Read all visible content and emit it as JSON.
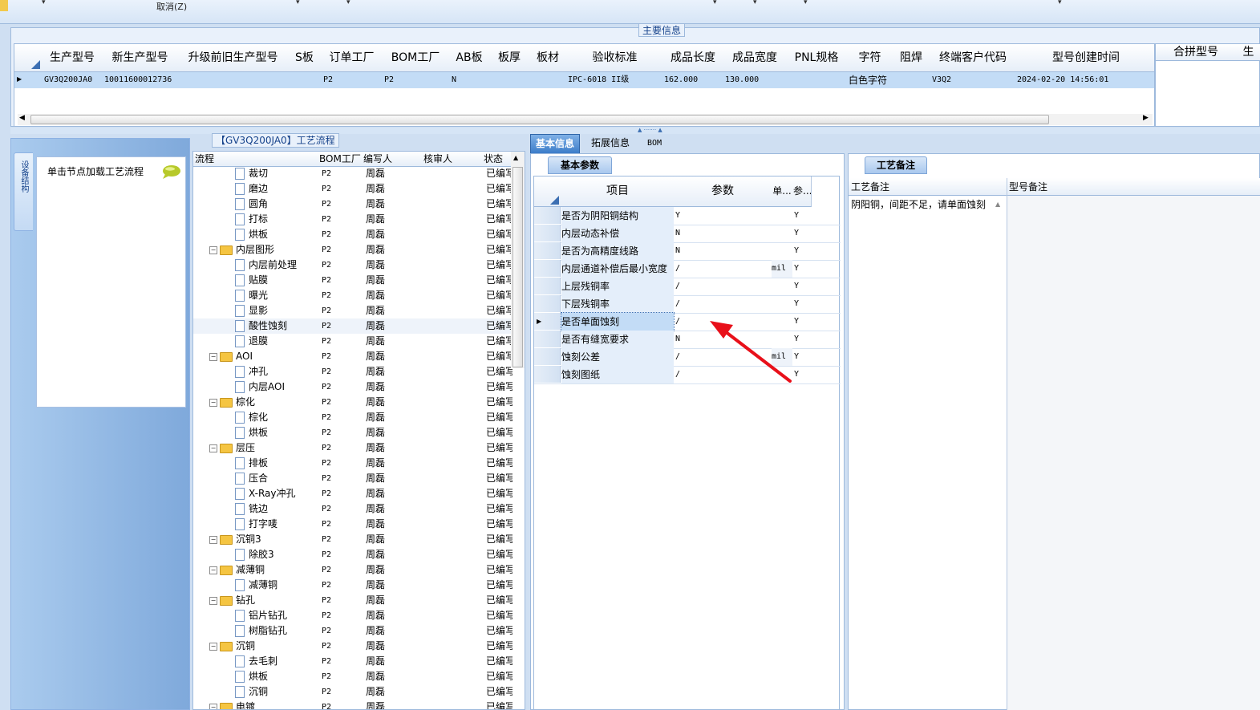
{
  "toolbar": {
    "cancel_label": "取消(Z)"
  },
  "main_info": {
    "group_title": "主要信息",
    "columns": [
      "生产型号",
      "新生产型号",
      "升级前旧生产型号",
      "S板",
      "订单工厂",
      "BOM工厂",
      "AB板",
      "板厚",
      "板材",
      "验收标准",
      "成品长度",
      "成品宽度",
      "PNL规格",
      "字符",
      "阻焊",
      "终端客户代码",
      "型号创建时间"
    ],
    "row": {
      "model": "GV3Q200JA0",
      "new_model": "10011600012736",
      "old_model": "",
      "s_board": "",
      "order_factory": "P2",
      "bom_factory": "P2",
      "ab_board": "N",
      "thickness": "",
      "material": "",
      "standard": "IPC-6018 II级",
      "length": "162.000",
      "width": "130.000",
      "pnl": "",
      "char": "白色字符",
      "solder": "",
      "customer_code": "V3Q2",
      "created": "2024-02-20 14:56:01"
    },
    "merge_columns": [
      "合拼型号",
      "生"
    ]
  },
  "left_panel": {
    "tab_label": "设备结构",
    "node_hint": "单击节点加载工艺流程"
  },
  "process_tree": {
    "title": "【GV3Q200JA0】工艺流程",
    "columns": [
      "流程",
      "BOM工厂",
      "编写人",
      "核审人",
      "状态"
    ],
    "rows": [
      {
        "name": "裁切",
        "level": 2,
        "type": "doc",
        "bom": "P2",
        "writer": "周磊",
        "status": "已编写"
      },
      {
        "name": "磨边",
        "level": 2,
        "type": "doc",
        "bom": "P2",
        "writer": "周磊",
        "status": "已编写"
      },
      {
        "name": "圆角",
        "level": 2,
        "type": "doc",
        "bom": "P2",
        "writer": "周磊",
        "status": "已编写"
      },
      {
        "name": "打标",
        "level": 2,
        "type": "doc",
        "bom": "P2",
        "writer": "周磊",
        "status": "已编写"
      },
      {
        "name": "烘板",
        "level": 2,
        "type": "doc",
        "bom": "P2",
        "writer": "周磊",
        "status": "已编写"
      },
      {
        "name": "内层图形",
        "level": 1,
        "type": "folder",
        "bom": "P2",
        "writer": "周磊",
        "status": "已编写"
      },
      {
        "name": "内层前处理",
        "level": 2,
        "type": "doc",
        "bom": "P2",
        "writer": "周磊",
        "status": "已编写"
      },
      {
        "name": "贴膜",
        "level": 2,
        "type": "doc",
        "bom": "P2",
        "writer": "周磊",
        "status": "已编写"
      },
      {
        "name": "曝光",
        "level": 2,
        "type": "doc",
        "bom": "P2",
        "writer": "周磊",
        "status": "已编写"
      },
      {
        "name": "显影",
        "level": 2,
        "type": "doc",
        "bom": "P2",
        "writer": "周磊",
        "status": "已编写"
      },
      {
        "name": "酸性蚀刻",
        "level": 2,
        "type": "doc",
        "bom": "P2",
        "writer": "周磊",
        "status": "已编写",
        "selected": true
      },
      {
        "name": "退膜",
        "level": 2,
        "type": "doc",
        "bom": "P2",
        "writer": "周磊",
        "status": "已编写"
      },
      {
        "name": "AOI",
        "level": 1,
        "type": "folder",
        "bom": "P2",
        "writer": "周磊",
        "status": "已编写"
      },
      {
        "name": "冲孔",
        "level": 2,
        "type": "doc",
        "bom": "P2",
        "writer": "周磊",
        "status": "已编写"
      },
      {
        "name": "内层AOI",
        "level": 2,
        "type": "doc",
        "bom": "P2",
        "writer": "周磊",
        "status": "已编写"
      },
      {
        "name": "棕化",
        "level": 1,
        "type": "folder",
        "bom": "P2",
        "writer": "周磊",
        "status": "已编写"
      },
      {
        "name": "棕化",
        "level": 2,
        "type": "doc",
        "bom": "P2",
        "writer": "周磊",
        "status": "已编写"
      },
      {
        "name": "烘板",
        "level": 2,
        "type": "doc",
        "bom": "P2",
        "writer": "周磊",
        "status": "已编写"
      },
      {
        "name": "层压",
        "level": 1,
        "type": "folder",
        "bom": "P2",
        "writer": "周磊",
        "status": "已编写"
      },
      {
        "name": "排板",
        "level": 2,
        "type": "doc",
        "bom": "P2",
        "writer": "周磊",
        "status": "已编写"
      },
      {
        "name": "压合",
        "level": 2,
        "type": "doc",
        "bom": "P2",
        "writer": "周磊",
        "status": "已编写"
      },
      {
        "name": "X-Ray冲孔",
        "level": 2,
        "type": "doc",
        "bom": "P2",
        "writer": "周磊",
        "status": "已编写"
      },
      {
        "name": "铣边",
        "level": 2,
        "type": "doc",
        "bom": "P2",
        "writer": "周磊",
        "status": "已编写"
      },
      {
        "name": "打字唛",
        "level": 2,
        "type": "doc",
        "bom": "P2",
        "writer": "周磊",
        "status": "已编写"
      },
      {
        "name": "沉铜3",
        "level": 1,
        "type": "folder",
        "bom": "P2",
        "writer": "周磊",
        "status": "已编写"
      },
      {
        "name": "除胶3",
        "level": 2,
        "type": "doc",
        "bom": "P2",
        "writer": "周磊",
        "status": "已编写"
      },
      {
        "name": "减薄铜",
        "level": 1,
        "type": "folder",
        "bom": "P2",
        "writer": "周磊",
        "status": "已编写"
      },
      {
        "name": "减薄铜",
        "level": 2,
        "type": "doc",
        "bom": "P2",
        "writer": "周磊",
        "status": "已编写"
      },
      {
        "name": "钻孔",
        "level": 1,
        "type": "folder",
        "bom": "P2",
        "writer": "周磊",
        "status": "已编写"
      },
      {
        "name": "铝片钻孔",
        "level": 2,
        "type": "doc",
        "bom": "P2",
        "writer": "周磊",
        "status": "已编写"
      },
      {
        "name": "树脂钻孔",
        "level": 2,
        "type": "doc",
        "bom": "P2",
        "writer": "周磊",
        "status": "已编写"
      },
      {
        "name": "沉铜",
        "level": 1,
        "type": "folder",
        "bom": "P2",
        "writer": "周磊",
        "status": "已编写"
      },
      {
        "name": "去毛刺",
        "level": 2,
        "type": "doc",
        "bom": "P2",
        "writer": "周磊",
        "status": "已编写"
      },
      {
        "name": "烘板",
        "level": 2,
        "type": "doc",
        "bom": "P2",
        "writer": "周磊",
        "status": "已编写"
      },
      {
        "name": "沉铜",
        "level": 2,
        "type": "doc",
        "bom": "P2",
        "writer": "周磊",
        "status": "已编写"
      },
      {
        "name": "电镀",
        "level": 1,
        "type": "folder",
        "bom": "P2",
        "writer": "周磊",
        "status": "已编写"
      }
    ]
  },
  "right_tabs": {
    "basic": "基本信息",
    "extended": "拓展信息",
    "bom": "BOM"
  },
  "params": {
    "tab": "基本参数",
    "columns": [
      "项目",
      "参数",
      "单...",
      "参..."
    ],
    "rows": [
      {
        "item": "是否为阴阳铜结构",
        "value": "Y",
        "unit": "",
        "req": "Y"
      },
      {
        "item": "内层动态补偿",
        "value": "N",
        "unit": "",
        "req": "Y"
      },
      {
        "item": "是否为高精度线路",
        "value": "N",
        "unit": "",
        "req": "Y"
      },
      {
        "item": "内层通道补偿后最小宽度",
        "value": "/",
        "unit": "mil",
        "req": "Y"
      },
      {
        "item": "上层残铜率",
        "value": "/",
        "unit": "",
        "req": "Y"
      },
      {
        "item": "下层残铜率",
        "value": "/",
        "unit": "",
        "req": "Y"
      },
      {
        "item": "是否单面蚀刻",
        "value": "/",
        "unit": "",
        "req": "Y",
        "selected": true
      },
      {
        "item": "是否有缝宽要求",
        "value": "N",
        "unit": "",
        "req": "Y"
      },
      {
        "item": "蚀刻公差",
        "value": "/",
        "unit": "mil",
        "req": "Y"
      },
      {
        "item": "蚀刻图纸",
        "value": "/",
        "unit": "",
        "req": "Y"
      }
    ]
  },
  "remarks": {
    "tab": "工艺备注",
    "col_process": "工艺备注",
    "col_model": "型号备注",
    "text": "阴阳铜，间距不足，请单面蚀刻"
  },
  "colors": {
    "accent": "#3c7dc9",
    "arrow": "#e8101a",
    "selected_row": "#c3dcf6"
  }
}
